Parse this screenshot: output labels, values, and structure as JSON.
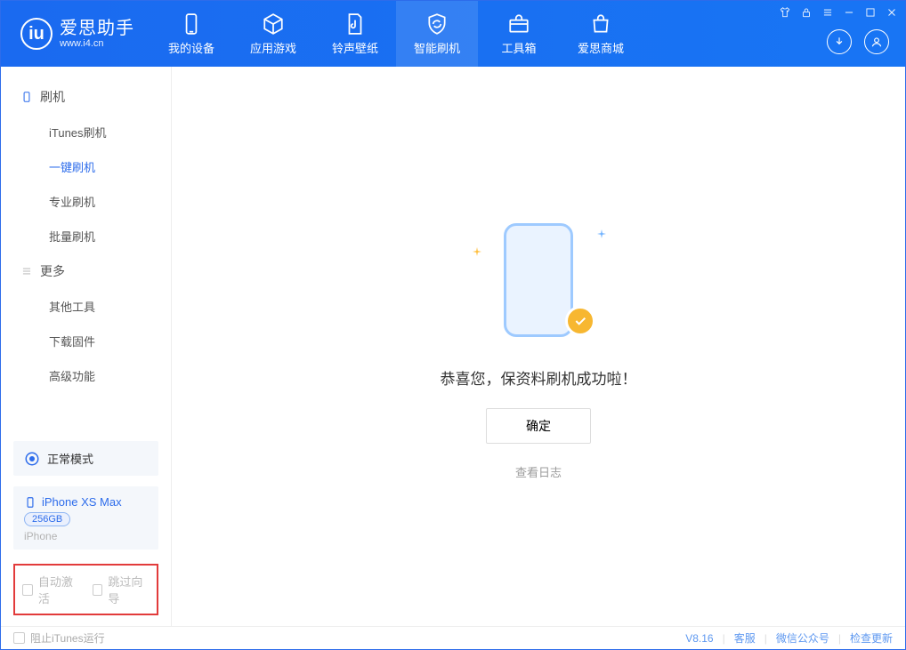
{
  "app": {
    "title": "爱思助手",
    "subtitle": "www.i4.cn"
  },
  "tabs": {
    "device": "我的设备",
    "apps": "应用游戏",
    "ring": "铃声壁纸",
    "flash": "智能刷机",
    "toolbox": "工具箱",
    "store": "爱思商城"
  },
  "sidebar": {
    "group_flash": "刷机",
    "items_flash": {
      "itunes": "iTunes刷机",
      "onekey": "一键刷机",
      "pro": "专业刷机",
      "batch": "批量刷机"
    },
    "group_more": "更多",
    "items_more": {
      "other": "其他工具",
      "fw": "下载固件",
      "adv": "高级功能"
    }
  },
  "mode": {
    "label": "正常模式"
  },
  "device": {
    "name": "iPhone XS Max",
    "capacity": "256GB",
    "sub": "iPhone"
  },
  "options": {
    "auto_activate": "自动激活",
    "skip_guide": "跳过向导"
  },
  "main": {
    "message": "恭喜您，保资料刷机成功啦！",
    "ok": "确定",
    "view_log": "查看日志"
  },
  "status": {
    "block_itunes": "阻止iTunes运行",
    "version": "V8.16",
    "cs": "客服",
    "wechat": "微信公众号",
    "update": "检查更新"
  }
}
